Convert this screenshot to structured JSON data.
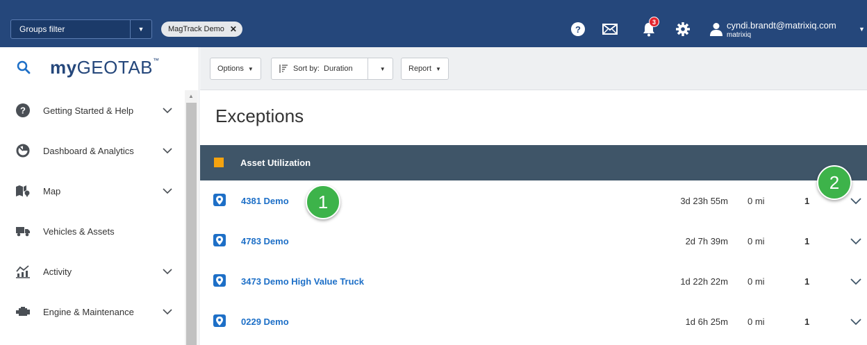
{
  "topbar": {
    "groups_filter": "Groups filter",
    "chip": "MagTrack Demo",
    "notifications_count": "3",
    "user_email": "cyndi.brandt@matrixiq.com",
    "user_org": "matrixiq"
  },
  "sidebar": {
    "logo_prefix": "my",
    "logo_suffix": "GEOTAB",
    "logo_tm": "™",
    "items": [
      {
        "label": "Getting Started & Help",
        "icon": "help-icon",
        "expandable": true
      },
      {
        "label": "Dashboard & Analytics",
        "icon": "pie-chart-icon",
        "expandable": true
      },
      {
        "label": "Map",
        "icon": "map-icon",
        "expandable": true
      },
      {
        "label": "Vehicles & Assets",
        "icon": "truck-icon",
        "expandable": false
      },
      {
        "label": "Activity",
        "icon": "activity-chart-icon",
        "expandable": true
      },
      {
        "label": "Engine & Maintenance",
        "icon": "engine-icon",
        "expandable": true
      }
    ]
  },
  "toolbar": {
    "options_label": "Options",
    "sort_label": "Sort by:  Duration",
    "report_label": "Report"
  },
  "page": {
    "title": "Exceptions",
    "group_label": "Asset Utilization",
    "group_color": "#f5a30f"
  },
  "rows": [
    {
      "name": "4381 Demo",
      "duration": "3d 23h 55m",
      "distance": "0 mi",
      "count": "1"
    },
    {
      "name": "4783 Demo",
      "duration": "2d 7h 39m",
      "distance": "0 mi",
      "count": "1"
    },
    {
      "name": "3473 Demo High Value Truck",
      "duration": "1d 22h 22m",
      "distance": "0 mi",
      "count": "1"
    },
    {
      "name": "0229 Demo",
      "duration": "1d 6h 25m",
      "distance": "0 mi",
      "count": "1"
    }
  ],
  "callouts": [
    "1",
    "2"
  ],
  "colors": {
    "topbar": "#25477b",
    "accent": "#1d6fc7",
    "callout": "#3db34a",
    "badge": "#e3262f"
  }
}
